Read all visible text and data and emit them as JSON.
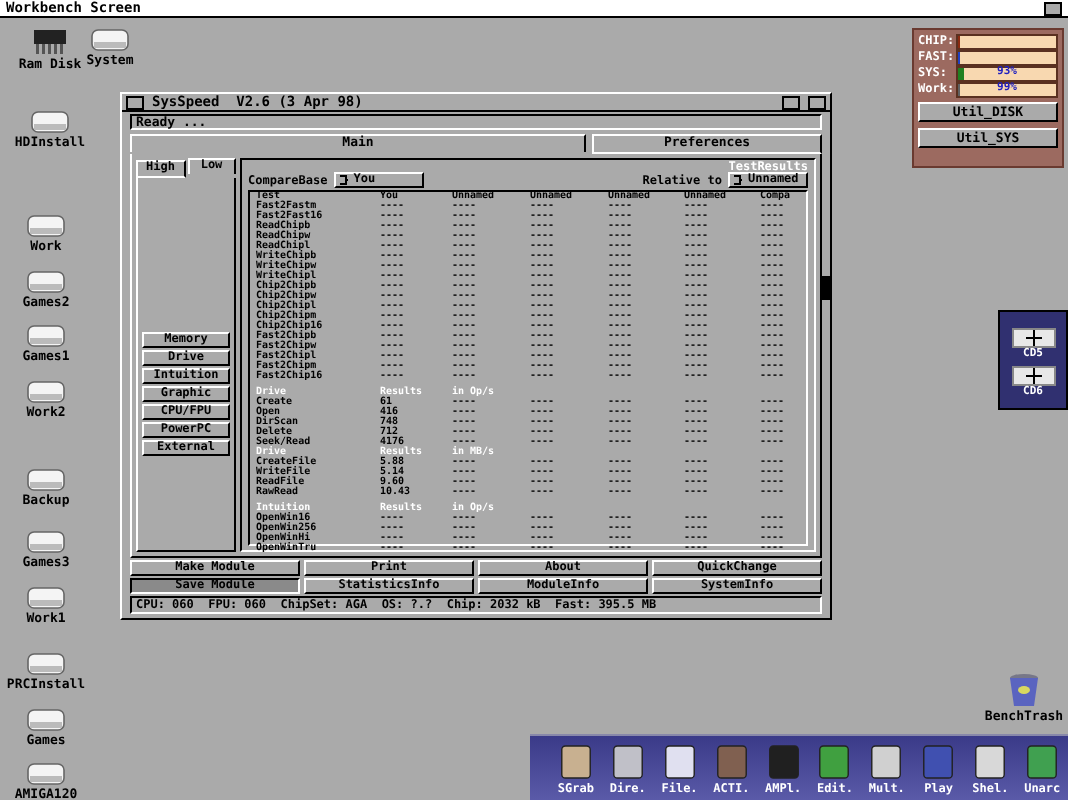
{
  "screen": {
    "title": "Workbench Screen"
  },
  "desktop_icons": [
    {
      "label": "Ram Disk",
      "kind": "ram"
    },
    {
      "label": "System",
      "kind": "drive"
    },
    {
      "label": "HDInstall",
      "kind": "drive"
    },
    {
      "label": "Work",
      "kind": "drive"
    },
    {
      "label": "Games2",
      "kind": "drive"
    },
    {
      "label": "Games1",
      "kind": "drive"
    },
    {
      "label": "Work2",
      "kind": "drive"
    },
    {
      "label": "Backup",
      "kind": "drive"
    },
    {
      "label": "Games3",
      "kind": "drive"
    },
    {
      "label": "Work1",
      "kind": "drive"
    },
    {
      "label": "PRCInstall",
      "kind": "drive"
    },
    {
      "label": "Games",
      "kind": "drive"
    },
    {
      "label": "AMIGA120",
      "kind": "drive"
    },
    {
      "label": "BenchTrash",
      "kind": "trash"
    }
  ],
  "window": {
    "title": "SysSpeed  V2.6 (3 Apr 98)",
    "status": "Ready ...",
    "tabs": [
      {
        "label": "Main",
        "selected": true
      },
      {
        "label": "Preferences",
        "selected": false
      }
    ],
    "subtabs": [
      {
        "label": "High",
        "selected": false
      },
      {
        "label": "Low",
        "selected": true
      }
    ],
    "modules": [
      "Memory",
      "Drive",
      "Intuition",
      "Graphic",
      "CPU/FPU",
      "PowerPC",
      "External"
    ],
    "group_title": "TestResults",
    "compare_label": "CompareBase",
    "compare_value": "You",
    "relative_label": "Relative to",
    "relative_value": "Unnamed",
    "columns": [
      "Test",
      "You",
      "Unnamed",
      "Unnamed",
      "Unnamed",
      "Unnamed",
      "Compa"
    ],
    "rows": [
      {
        "kind": "row",
        "cells": [
          "Fast2Fastm",
          "----",
          "----",
          "----",
          "----",
          "----",
          "----"
        ]
      },
      {
        "kind": "row",
        "cells": [
          "Fast2Fast16",
          "----",
          "----",
          "----",
          "----",
          "----",
          "----"
        ]
      },
      {
        "kind": "row",
        "cells": [
          "ReadChipb",
          "----",
          "----",
          "----",
          "----",
          "----",
          "----"
        ]
      },
      {
        "kind": "row",
        "cells": [
          "ReadChipw",
          "----",
          "----",
          "----",
          "----",
          "----",
          "----"
        ]
      },
      {
        "kind": "row",
        "cells": [
          "ReadChipl",
          "----",
          "----",
          "----",
          "----",
          "----",
          "----"
        ]
      },
      {
        "kind": "row",
        "cells": [
          "WriteChipb",
          "----",
          "----",
          "----",
          "----",
          "----",
          "----"
        ]
      },
      {
        "kind": "row",
        "cells": [
          "WriteChipw",
          "----",
          "----",
          "----",
          "----",
          "----",
          "----"
        ]
      },
      {
        "kind": "row",
        "cells": [
          "WriteChipl",
          "----",
          "----",
          "----",
          "----",
          "----",
          "----"
        ]
      },
      {
        "kind": "row",
        "cells": [
          "Chip2Chipb",
          "----",
          "----",
          "----",
          "----",
          "----",
          "----"
        ]
      },
      {
        "kind": "row",
        "cells": [
          "Chip2Chipw",
          "----",
          "----",
          "----",
          "----",
          "----",
          "----"
        ]
      },
      {
        "kind": "row",
        "cells": [
          "Chip2Chipl",
          "----",
          "----",
          "----",
          "----",
          "----",
          "----"
        ]
      },
      {
        "kind": "row",
        "cells": [
          "Chip2Chipm",
          "----",
          "----",
          "----",
          "----",
          "----",
          "----"
        ]
      },
      {
        "kind": "row",
        "cells": [
          "Chip2Chip16",
          "----",
          "----",
          "----",
          "----",
          "----",
          "----"
        ]
      },
      {
        "kind": "row",
        "cells": [
          "Fast2Chipb",
          "----",
          "----",
          "----",
          "----",
          "----",
          "----"
        ]
      },
      {
        "kind": "row",
        "cells": [
          "Fast2Chipw",
          "----",
          "----",
          "----",
          "----",
          "----",
          "----"
        ]
      },
      {
        "kind": "row",
        "cells": [
          "Fast2Chipl",
          "----",
          "----",
          "----",
          "----",
          "----",
          "----"
        ]
      },
      {
        "kind": "row",
        "cells": [
          "Fast2Chipm",
          "----",
          "----",
          "----",
          "----",
          "----",
          "----"
        ]
      },
      {
        "kind": "row",
        "cells": [
          "Fast2Chip16",
          "----",
          "----",
          "----",
          "----",
          "----",
          "----"
        ]
      },
      {
        "kind": "spacer"
      },
      {
        "kind": "section",
        "cells": [
          "Drive",
          "Results",
          "in Op/s"
        ]
      },
      {
        "kind": "row",
        "cells": [
          "Create",
          "61",
          "----",
          "----",
          "----",
          "----",
          "----"
        ]
      },
      {
        "kind": "row",
        "cells": [
          "Open",
          "416",
          "----",
          "----",
          "----",
          "----",
          "----"
        ]
      },
      {
        "kind": "row",
        "cells": [
          "DirScan",
          "748",
          "----",
          "----",
          "----",
          "----",
          "----"
        ]
      },
      {
        "kind": "row",
        "cells": [
          "Delete",
          "712",
          "----",
          "----",
          "----",
          "----",
          "----"
        ]
      },
      {
        "kind": "row",
        "cells": [
          "Seek/Read",
          "4176",
          "----",
          "----",
          "----",
          "----",
          "----"
        ]
      },
      {
        "kind": "section",
        "cells": [
          "Drive",
          "Results",
          "in MB/s"
        ]
      },
      {
        "kind": "row",
        "cells": [
          "CreateFile",
          "5.88",
          "----",
          "----",
          "----",
          "----",
          "----"
        ]
      },
      {
        "kind": "row",
        "cells": [
          "WriteFile",
          "5.14",
          "----",
          "----",
          "----",
          "----",
          "----"
        ]
      },
      {
        "kind": "row",
        "cells": [
          "ReadFile",
          "9.60",
          "----",
          "----",
          "----",
          "----",
          "----"
        ]
      },
      {
        "kind": "row",
        "cells": [
          "RawRead",
          "10.43",
          "----",
          "----",
          "----",
          "----",
          "----"
        ]
      },
      {
        "kind": "spacer"
      },
      {
        "kind": "section",
        "cells": [
          "Intuition",
          "Results",
          "in Op/s"
        ]
      },
      {
        "kind": "row",
        "cells": [
          "OpenWin16",
          "----",
          "----",
          "----",
          "----",
          "----",
          "----"
        ]
      },
      {
        "kind": "row",
        "cells": [
          "OpenWin256",
          "----",
          "----",
          "----",
          "----",
          "----",
          "----"
        ]
      },
      {
        "kind": "row",
        "cells": [
          "OpenWinHi",
          "----",
          "----",
          "----",
          "----",
          "----",
          "----"
        ]
      },
      {
        "kind": "row",
        "cells": [
          "OpenWinTru",
          "----",
          "----",
          "----",
          "----",
          "----",
          "----"
        ]
      }
    ],
    "buttons": [
      {
        "label": "Make Module",
        "selected": false
      },
      {
        "label": "Print",
        "selected": false
      },
      {
        "label": "About",
        "selected": false
      },
      {
        "label": "QuickChange",
        "selected": false
      },
      {
        "label": "Save Module",
        "selected": true
      },
      {
        "label": "StatisticsInfo",
        "selected": false
      },
      {
        "label": "ModuleInfo",
        "selected": false
      },
      {
        "label": "SystemInfo",
        "selected": false
      }
    ],
    "info_bar": "CPU: 060  FPU: 060  ChipSet: AGA  OS: ?.?  Chip: 2032 kB  Fast: 395.5 MB"
  },
  "monitor": {
    "meters": [
      {
        "label": "CHIP:",
        "level": 0.03,
        "color": "#8a2a10"
      },
      {
        "label": "FAST:",
        "level": 0.03,
        "color": "#2040c0"
      },
      {
        "label": "SYS:",
        "level": 0.07,
        "color": "#208020",
        "reading": "93%"
      },
      {
        "label": "Work:",
        "level": 0.03,
        "color": "#606060",
        "reading": "99%"
      }
    ],
    "buttons": [
      "Util_DISK",
      "Util_SYS"
    ]
  },
  "cd_dock": [
    "CD5",
    "CD6"
  ],
  "dock": [
    "SGrab",
    "Dire.",
    "File.",
    "ACTI.",
    "AMPl.",
    "Edit.",
    "Mult.",
    "Play",
    "Shel.",
    "Unarc"
  ]
}
